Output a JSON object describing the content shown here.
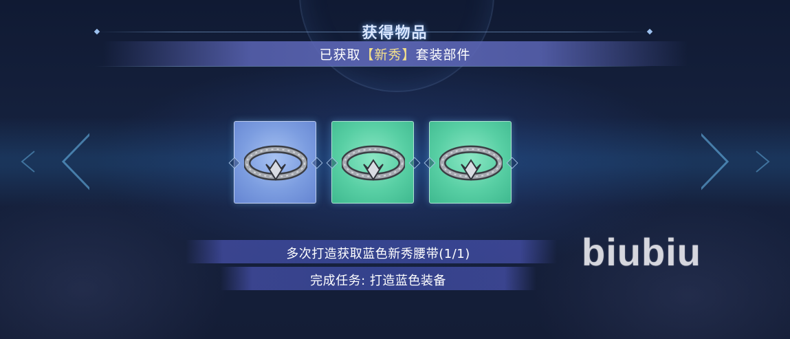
{
  "header": {
    "title": "获得物品",
    "subtitle_prefix": "已获取",
    "set_name": "【新秀】",
    "subtitle_suffix": "套装部件"
  },
  "items": [
    {
      "name": "belt-icon",
      "rarity": "blue"
    },
    {
      "name": "belt-icon",
      "rarity": "green"
    },
    {
      "name": "belt-icon",
      "rarity": "green"
    }
  ],
  "tasks": {
    "progress": "多次打造获取蓝色新秀腰带(1/1)",
    "complete": "完成任务: 打造蓝色装备"
  },
  "watermark": "biubiu",
  "colors": {
    "blue_rarity": "#7c9de0",
    "green_rarity": "#58cfa4",
    "set_highlight": "#f3e08c"
  }
}
